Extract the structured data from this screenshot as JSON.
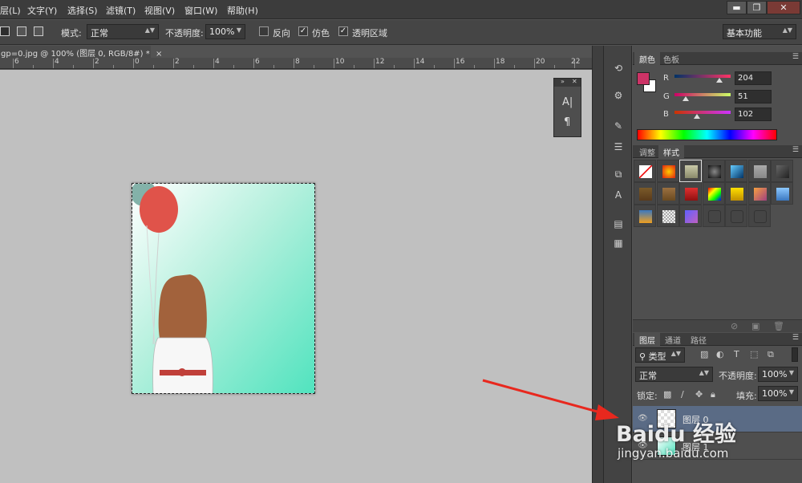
{
  "menu": {
    "items": [
      "层(L)",
      "文字(Y)",
      "选择(S)",
      "滤镜(T)",
      "视图(V)",
      "窗口(W)",
      "帮助(H)"
    ],
    "window_controls": [
      "▬",
      "❐",
      "✕"
    ]
  },
  "options": {
    "mode_label": "模式:",
    "mode_value": "正常",
    "opacity_label": "不透明度:",
    "opacity_value": "100%",
    "reverse_label": "反向",
    "dither_label": "仿色",
    "transparency_label": "透明区域",
    "workspace_value": "基本功能"
  },
  "document": {
    "tab_title": "gp=0.jpg @ 100% (图层 0, RGB/8#) *",
    "tab_close": "×",
    "ruler_numbers": [
      "6",
      "4",
      "2",
      "0",
      "2",
      "4",
      "6",
      "8",
      "10",
      "12",
      "14",
      "16",
      "18",
      "20",
      "22"
    ]
  },
  "float_panel": {
    "collapse": "»",
    "close": "✕",
    "char_icon": "A|",
    "para_icon": "¶"
  },
  "color_panel": {
    "tabs": [
      "颜色",
      "色板"
    ],
    "channels": [
      {
        "label": "R",
        "value": "204",
        "level": 0.8
      },
      {
        "label": "G",
        "value": "51",
        "level": 0.2
      },
      {
        "label": "B",
        "value": "102",
        "level": 0.4
      }
    ],
    "foreground": "#cc3366",
    "background": "#ffffff"
  },
  "styles_panel": {
    "tabs": [
      "调整",
      "样式"
    ]
  },
  "layers_panel": {
    "tabs": [
      "图层",
      "通道",
      "路径"
    ],
    "filter_value": "类型",
    "blend_value": "正常",
    "opacity_label": "不透明度:",
    "opacity_value": "100%",
    "lock_label": "锁定:",
    "fill_label": "填充:",
    "fill_value": "100%",
    "layers": [
      {
        "name": "图层 0",
        "selected": true
      },
      {
        "name": "图层 1",
        "selected": false
      }
    ]
  },
  "watermark": {
    "main": "Baidu 经验",
    "sub": "jingyan.baidu.com"
  },
  "colors": {
    "accent_arrow": "#e8281e",
    "canvas_bg": "#c0c0c0",
    "selected_layer": "#5a6b85"
  }
}
